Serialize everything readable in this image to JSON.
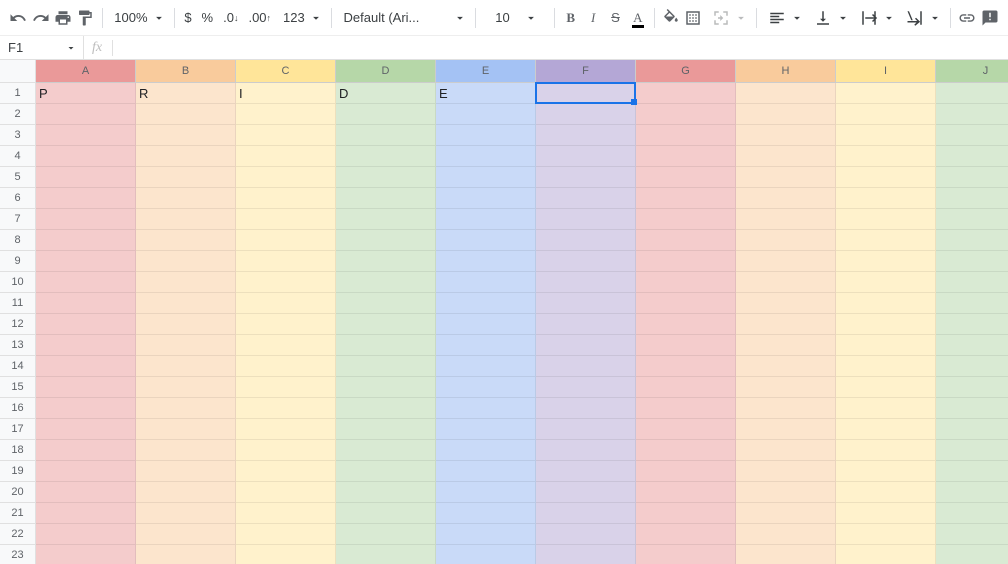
{
  "toolbar": {
    "zoom": "100%",
    "font": "Default (Ari...",
    "fontSize": "10",
    "decimalFormats": {
      "dec": ".0",
      "inc": ".00",
      "more": "123"
    }
  },
  "nameBox": {
    "cellRef": "F1",
    "fxLabel": "fx"
  },
  "grid": {
    "columns": [
      "A",
      "B",
      "C",
      "D",
      "E",
      "F",
      "G",
      "H",
      "I",
      "J"
    ],
    "visibleRowCount": 23,
    "columnColors": {
      "headers": [
        "#ea9999",
        "#f9cb9c",
        "#ffe599",
        "#b6d7a8",
        "#a4c2f4",
        "#b4a7d6",
        "#ea9999",
        "#f9cb9c",
        "#ffe599",
        "#b6d7a8"
      ],
      "cells": [
        "#f4cccc",
        "#fce5cd",
        "#fff2cc",
        "#d9ead3",
        "#c9daf8",
        "#d9d2e9",
        "#f4cccc",
        "#fce5cd",
        "#fff2cc",
        "#d9ead3"
      ]
    },
    "data": {
      "A1": "P",
      "B1": "R",
      "C1": "I",
      "D1": "D",
      "E1": "E"
    },
    "activeCell": {
      "col": 5,
      "row": 0
    }
  }
}
